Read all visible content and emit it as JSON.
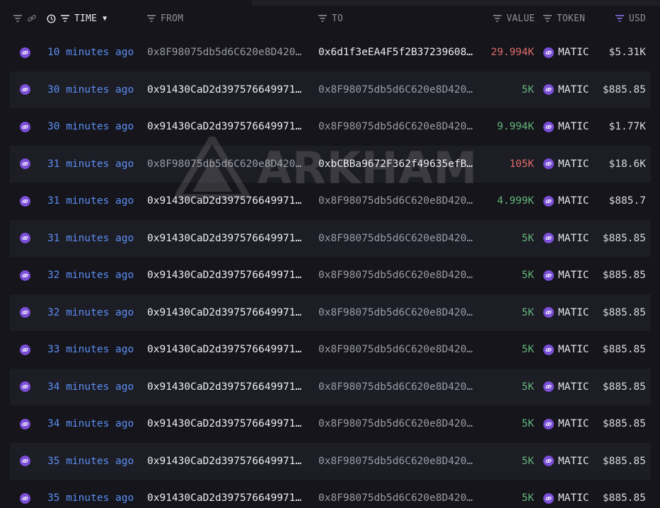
{
  "header": {
    "time": "TIME",
    "from": "FROM",
    "to": "TO",
    "value": "VALUE",
    "token": "TOKEN",
    "usd": "USD"
  },
  "watermark": "ARKHAM",
  "rows": [
    {
      "time": "10 minutes ago",
      "from": "0x8F98075db5d6C620e8D420…",
      "to": "0x6d1f3eEA4F5f2B37239608…",
      "value": "29.994K",
      "token": "MATIC",
      "usd": "$5.31K"
    },
    {
      "time": "30 minutes ago",
      "from": "0x91430CaD2d397576649971…",
      "to": "0x8F98075db5d6C620e8D420…",
      "value": "5K",
      "token": "MATIC",
      "usd": "$885.85"
    },
    {
      "time": "30 minutes ago",
      "from": "0x91430CaD2d397576649971…",
      "to": "0x8F98075db5d6C620e8D420…",
      "value": "9.994K",
      "token": "MATIC",
      "usd": "$1.77K"
    },
    {
      "time": "31 minutes ago",
      "from": "0x8F98075db5d6C620e8D420…",
      "to": "0xbCBBa9672F362f49635efB…",
      "value": "105K",
      "token": "MATIC",
      "usd": "$18.6K"
    },
    {
      "time": "31 minutes ago",
      "from": "0x91430CaD2d397576649971…",
      "to": "0x8F98075db5d6C620e8D420…",
      "value": "4.999K",
      "token": "MATIC",
      "usd": "$885.7"
    },
    {
      "time": "31 minutes ago",
      "from": "0x91430CaD2d397576649971…",
      "to": "0x8F98075db5d6C620e8D420…",
      "value": "5K",
      "token": "MATIC",
      "usd": "$885.85"
    },
    {
      "time": "32 minutes ago",
      "from": "0x91430CaD2d397576649971…",
      "to": "0x8F98075db5d6C620e8D420…",
      "value": "5K",
      "token": "MATIC",
      "usd": "$885.85"
    },
    {
      "time": "32 minutes ago",
      "from": "0x91430CaD2d397576649971…",
      "to": "0x8F98075db5d6C620e8D420…",
      "value": "5K",
      "token": "MATIC",
      "usd": "$885.85"
    },
    {
      "time": "33 minutes ago",
      "from": "0x91430CaD2d397576649971…",
      "to": "0x8F98075db5d6C620e8D420…",
      "value": "5K",
      "token": "MATIC",
      "usd": "$885.85"
    },
    {
      "time": "34 minutes ago",
      "from": "0x91430CaD2d397576649971…",
      "to": "0x8F98075db5d6C620e8D420…",
      "value": "5K",
      "token": "MATIC",
      "usd": "$885.85"
    },
    {
      "time": "34 minutes ago",
      "from": "0x91430CaD2d397576649971…",
      "to": "0x8F98075db5d6C620e8D420…",
      "value": "5K",
      "token": "MATIC",
      "usd": "$885.85"
    },
    {
      "time": "35 minutes ago",
      "from": "0x91430CaD2d397576649971…",
      "to": "0x8F98075db5d6C620e8D420…",
      "value": "5K",
      "token": "MATIC",
      "usd": "$885.85"
    },
    {
      "time": "35 minutes ago",
      "from": "0x91430CaD2d397576649971…",
      "to": "0x8F98075db5d6C620e8D420…",
      "value": "5K",
      "token": "MATIC",
      "usd": "$885.85"
    }
  ],
  "icons": {
    "row_link": "link-icon",
    "token": "polygon-token-icon",
    "filter": "filter-icon",
    "clock": "clock-icon"
  },
  "colors": {
    "background": "#15151b",
    "alt_row": "#1d1d25",
    "time_link": "#5b8ef2",
    "value_in": "#62b37a",
    "value_out": "#e06b6b",
    "token_purple": "#7b4fd8"
  }
}
